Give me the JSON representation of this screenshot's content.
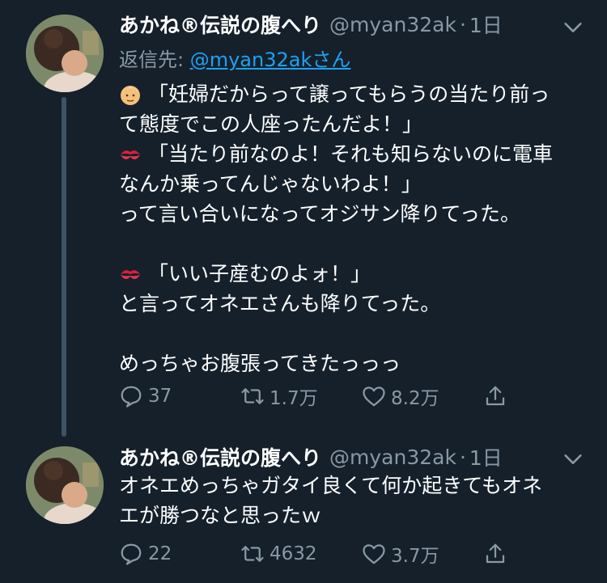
{
  "tweets": [
    {
      "author_name": "あかね®伝説の腹へり",
      "handle": "@myan32ak",
      "separator": "·",
      "time": "1日",
      "reply_to_label": "返信先: ",
      "reply_to_handle": "@myan32akさん",
      "lines": [
        {
          "emoji": "old-man-emoji",
          "text": "「妊婦だからって譲ってもらうの当たり前っ"
        },
        {
          "emoji": "",
          "text": "て態度でこの人座ったんだよ！」"
        },
        {
          "emoji": "kiss-mark-emoji",
          "text": "「当たり前なのよ！それも知らないのに電車"
        },
        {
          "emoji": "",
          "text": "なんか乗ってんじゃないわよ！」"
        },
        {
          "emoji": "",
          "text": "って言い合いになってオジサン降りてった。"
        },
        {
          "emoji": "",
          "text": ""
        },
        {
          "emoji": "kiss-mark-emoji",
          "text": "「いい子産むのよォ！」"
        },
        {
          "emoji": "",
          "text": "と言ってオネエさんも降りてった。"
        },
        {
          "emoji": "",
          "text": ""
        },
        {
          "emoji": "",
          "text": "めっちゃお腹張ってきたっっっ"
        }
      ],
      "replies": "37",
      "retweets": "1.7万",
      "likes": "8.2万"
    },
    {
      "author_name": "あかね®伝説の腹へり",
      "handle": "@myan32ak",
      "separator": "·",
      "time": "1日",
      "lines": [
        {
          "emoji": "",
          "text": "オネエめっちゃガタイ良くて何か起きてもオネ"
        },
        {
          "emoji": "",
          "text": "エが勝つなと思ったｗ"
        }
      ],
      "replies": "22",
      "retweets": "4632",
      "likes": "3.7万"
    }
  ],
  "colors": {
    "background": "#15202b",
    "secondary_text": "#8899a6",
    "link": "#1da1f2",
    "thread_line": "#3d5466"
  }
}
